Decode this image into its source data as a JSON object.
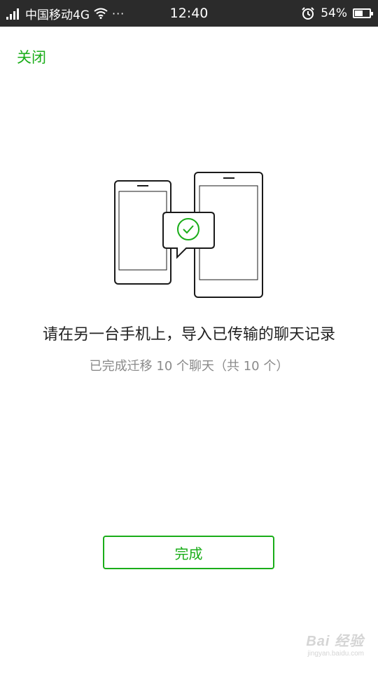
{
  "status_bar": {
    "carrier": "中国移动4G",
    "more": "···",
    "time": "12:40",
    "battery": "54%",
    "battery_level": 0.54
  },
  "header": {
    "close_label": "关闭"
  },
  "main": {
    "title": "请在另一台手机上，导入已传输的聊天记录",
    "subtitle": "已完成迁移 10 个聊天（共 10 个）"
  },
  "footer": {
    "done_label": "完成"
  },
  "watermark": {
    "text": "Bai 经验",
    "url": "jingyan.baidu.com"
  },
  "colors": {
    "accent": "#1aad19",
    "status_bar_bg": "#2b2b2b"
  }
}
